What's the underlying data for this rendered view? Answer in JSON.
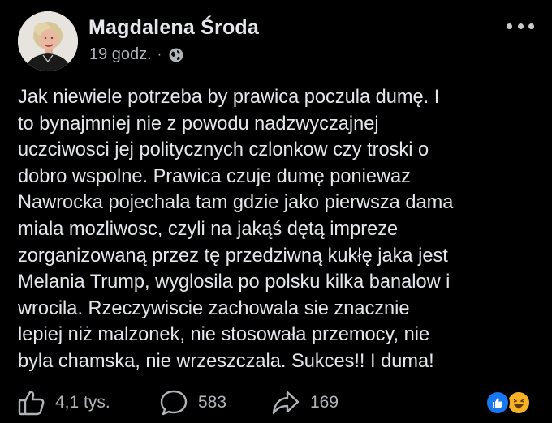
{
  "post": {
    "author": "Magdalena Środa",
    "time": "19 godz.",
    "separator": "·",
    "audience_icon": "globe-icon",
    "more_icon": "more-options-icon",
    "text_lines": [
      "Jak niewiele potrzeba by prawica poczula dumę. I",
      "to bynajmniej nie z powodu nadzwyczajnej",
      "uczciwosci jej politycznych czlonkow czy troski o",
      "dobro wspolne. Prawica czuje dumę poniewaz",
      "Nawrocka pojechala tam gdzie jako pierwsza dama",
      "miala mozliwosc, czyli na jakąś dętą impreze",
      "zorganizowaną przez tę przedziwną kukłę jaka jest",
      "Melania Trump, wyglosila po polsku kilka banalow i",
      "wrocila. Rzeczywiscie zachowala sie znacznie",
      "lepiej niż malzonek, nie stosowała przemocy, nie",
      "byla chamska, nie wrzeszczala. Sukces!! I duma!"
    ]
  },
  "actions": {
    "like": {
      "icon": "like-icon",
      "count": "4,1 tys."
    },
    "comment": {
      "icon": "comment-icon",
      "count": "583"
    },
    "share": {
      "icon": "share-icon",
      "count": "169"
    }
  },
  "reactions": [
    "like-reaction-icon",
    "haha-reaction-icon"
  ],
  "colors": {
    "background": "#000000",
    "text": "#e4e6eb",
    "secondary": "#b0b3b8",
    "like_blue": "#1877f2",
    "haha_yellow": "#f7b125"
  }
}
